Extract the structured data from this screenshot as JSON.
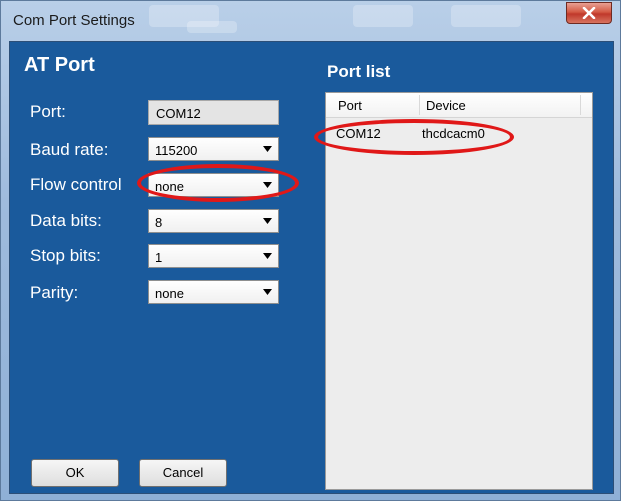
{
  "window": {
    "title": "Com Port Settings",
    "close_symbol": "x"
  },
  "at_port": {
    "title": "AT Port",
    "fields": [
      {
        "label": "Port:",
        "value": "COM12",
        "kind": "readonly"
      },
      {
        "label": "Baud rate:",
        "value": "115200",
        "kind": "dropdown"
      },
      {
        "label": "Flow control",
        "value": "none",
        "kind": "dropdown"
      },
      {
        "label": "Data bits:",
        "value": "8",
        "kind": "dropdown"
      },
      {
        "label": "Stop bits:",
        "value": "1",
        "kind": "dropdown"
      },
      {
        "label": "Parity:",
        "value": "none",
        "kind": "dropdown"
      }
    ]
  },
  "port_list": {
    "title": "Port list",
    "columns": [
      "Port",
      "Device"
    ],
    "rows": [
      {
        "port": "COM12",
        "device": "thcdcacm0"
      }
    ]
  },
  "buttons": {
    "ok": "OK",
    "cancel": "Cancel"
  },
  "colors": {
    "panel_background": "#1a5a9c",
    "annotation": "#e01818"
  }
}
